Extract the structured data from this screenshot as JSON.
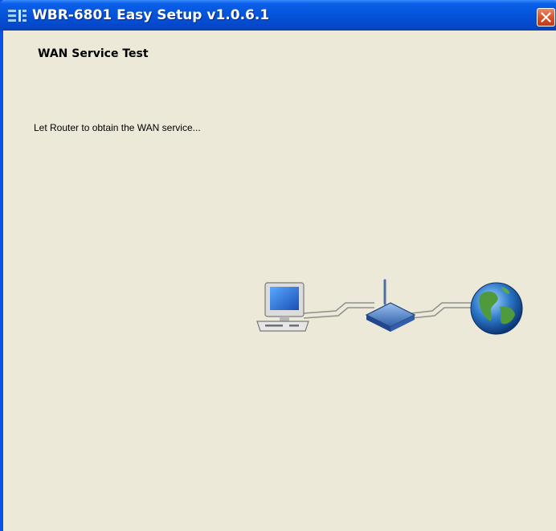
{
  "window": {
    "title": "WBR-6801 Easy Setup v1.0.6.1",
    "icons": {
      "app": "network-app-icon",
      "close": "close-icon"
    }
  },
  "page": {
    "heading": "WAN Service Test",
    "message": "Let Router to obtain the WAN service..."
  },
  "diagram": {
    "icons": [
      "computer-icon",
      "router-icon",
      "globe-icon"
    ]
  },
  "colors": {
    "titlebar": "#0553db",
    "background": "#ece9d8",
    "close_button": "#d9532c"
  }
}
